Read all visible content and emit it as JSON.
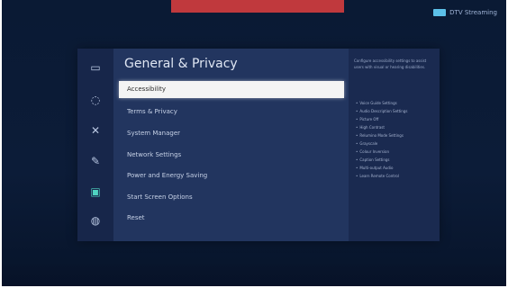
{
  "app": {
    "status_text": "DTV Streaming",
    "colors": {
      "accent": "#4fd4c1",
      "top_bar": "#c0393d",
      "selection": "#f4f4f4"
    }
  },
  "menu": {
    "title": "General & Privacy",
    "items": [
      {
        "label": "Accessibility",
        "selected": true
      },
      {
        "label": "Terms & Privacy",
        "selected": false
      },
      {
        "label": "System Manager",
        "selected": false
      },
      {
        "label": "Network Settings",
        "selected": false
      },
      {
        "label": "Power and Energy Saving",
        "selected": false
      },
      {
        "label": "Start Screen Options",
        "selected": false
      },
      {
        "label": "Reset",
        "selected": false
      }
    ]
  },
  "rail_icons": [
    {
      "name": "picture-icon",
      "glyph": "▭"
    },
    {
      "name": "sound-icon",
      "glyph": "◌"
    },
    {
      "name": "tools-icon",
      "glyph": "✕"
    },
    {
      "name": "connection-icon",
      "glyph": "✎"
    },
    {
      "name": "general-icon",
      "glyph": "▣",
      "active": true
    },
    {
      "name": "support-icon",
      "glyph": "◍"
    }
  ],
  "side_panel": {
    "description": "Configure accessibility settings to assist users with visual or hearing disabilities.",
    "items": [
      "Voice Guide Settings",
      "Audio Description Settings",
      "Picture Off",
      "High Contrast",
      "Relumino Mode Settings",
      "Grayscale",
      "Colour Inversion",
      "Caption Settings",
      "Multi-output Audio",
      "Learn Remote Control"
    ]
  }
}
